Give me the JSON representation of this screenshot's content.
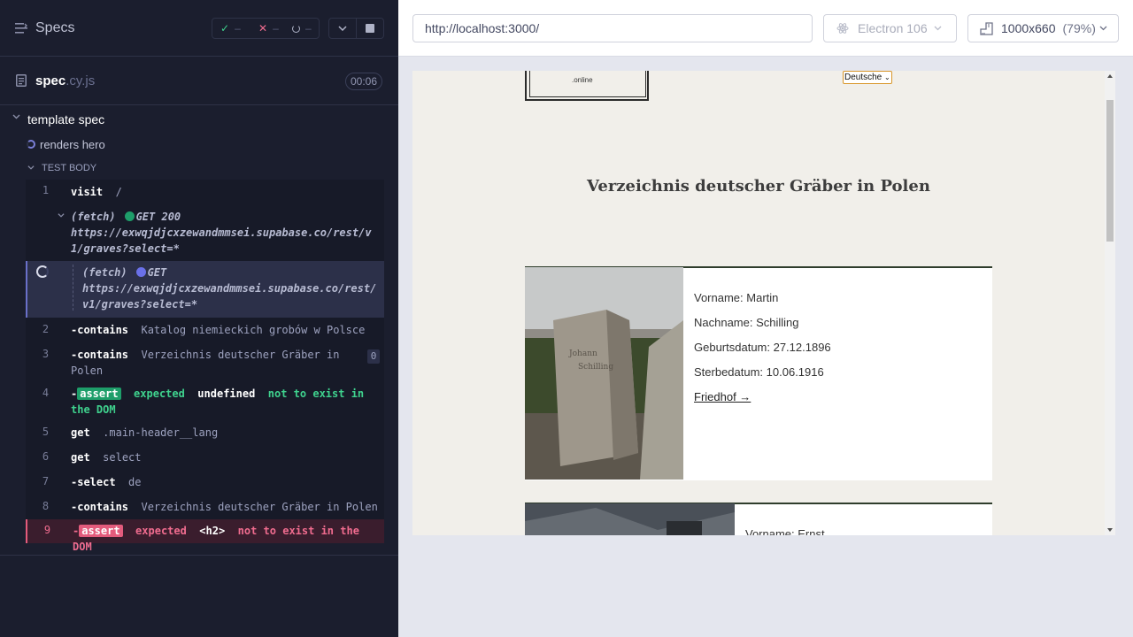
{
  "reporter": {
    "title": "Specs",
    "stats": {
      "passed": "–",
      "failed": "–",
      "pending": "–"
    },
    "spec": {
      "name": "spec",
      "ext": ".cy.js",
      "duration": "00:06"
    },
    "suite": "template spec",
    "test": "renders hero",
    "test_body_label": "TEST BODY",
    "commands": {
      "c1": {
        "num": "1",
        "name": "visit",
        "msg": "/"
      },
      "f1": {
        "name": "(fetch)",
        "method": "GET 200",
        "url": "https://exwqjdjcxzewandmmsei.supabase.co/rest/v1/graves?select=*"
      },
      "f2": {
        "name": "(fetch)",
        "method": "GET",
        "url": "https://exwqjdjcxzewandmmsei.supabase.co/rest/v1/graves?select=*"
      },
      "c2": {
        "num": "2",
        "name": "-contains",
        "msg": "Katalog niemieckich grobów w Polsce"
      },
      "c3": {
        "num": "3",
        "name": "-contains",
        "msg": "Verzeichnis deutscher Gräber in Polen",
        "count": "0"
      },
      "c4": {
        "num": "4",
        "prefix": "-",
        "badge": "assert",
        "msg1": "expected",
        "msg2": "undefined",
        "msg3": "not to exist in the DOM"
      },
      "c5": {
        "num": "5",
        "name": "get",
        "msg": ".main-header__lang"
      },
      "c6": {
        "num": "6",
        "name": "get",
        "msg": "select"
      },
      "c7": {
        "num": "7",
        "name": "-select",
        "msg": "de"
      },
      "c8": {
        "num": "8",
        "name": "-contains",
        "msg": "Verzeichnis deutscher Gräber in Polen"
      },
      "c9": {
        "num": "9",
        "prefix": "-",
        "badge": "assert",
        "msg1": "expected",
        "msg2": "<h2>",
        "msg3": "not to exist in the DOM"
      }
    }
  },
  "aut": {
    "url": "http://localhost:3000/",
    "browser": "Electron 106",
    "viewport": "1000x660",
    "scale": "(79%)"
  },
  "page": {
    "logo_text": ".online",
    "lang_selected": "Deutsche",
    "hero_title": "Verzeichnis deutscher Gräber in Polen",
    "cards": [
      {
        "first": "Vorname: Martin",
        "last": "Nachname: Schilling",
        "born": "Geburtsdatum: 27.12.1896",
        "died": "Sterbedatum: 10.06.1916",
        "link": "Friedhof →"
      },
      {
        "first": "Vorname: Ernst"
      }
    ]
  },
  "colors": {
    "reporter_bg": "#1b1e2e",
    "pass": "#1e9e6a",
    "fail": "#e35b7c",
    "page_bg": "#f1efea"
  }
}
